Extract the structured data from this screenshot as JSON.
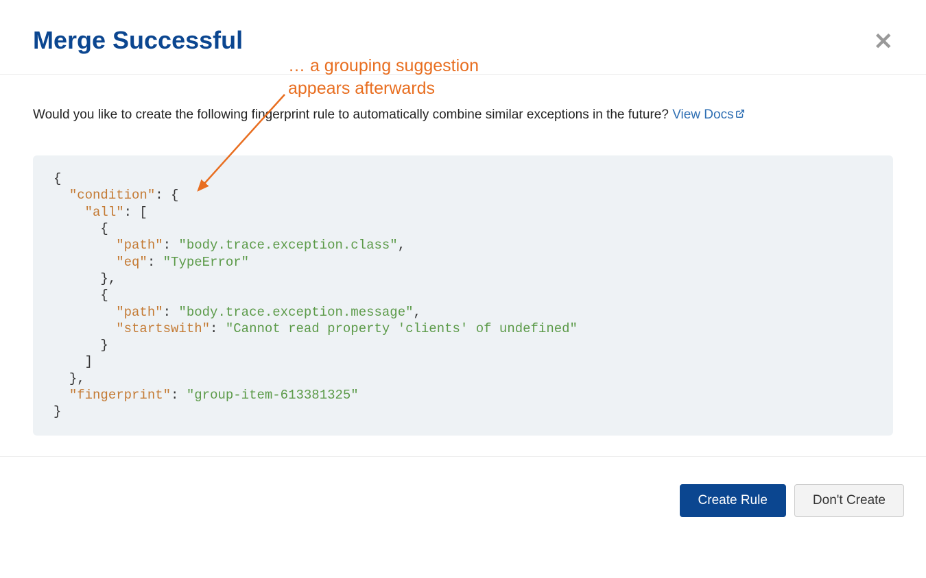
{
  "header": {
    "title": "Merge Successful"
  },
  "annotation": {
    "line1": "… a grouping suggestion",
    "line2": "appears afterwards"
  },
  "body": {
    "prompt_text": "Would you like to create the following fingerprint rule to automatically combine similar exceptions in the future? ",
    "docs_link_label": "View Docs"
  },
  "code": {
    "key_condition": "\"condition\"",
    "key_all": "\"all\"",
    "key_path": "\"path\"",
    "key_eq": "\"eq\"",
    "key_startswith": "\"startswith\"",
    "key_fingerprint": "\"fingerprint\"",
    "val_path1": "\"body.trace.exception.class\"",
    "val_eq": "\"TypeError\"",
    "val_path2": "\"body.trace.exception.message\"",
    "val_startswith": "\"Cannot read property 'clients' of undefined\"",
    "val_fingerprint": "\"group-item-613381325\""
  },
  "footer": {
    "create_label": "Create Rule",
    "dont_create_label": "Don't Create"
  }
}
